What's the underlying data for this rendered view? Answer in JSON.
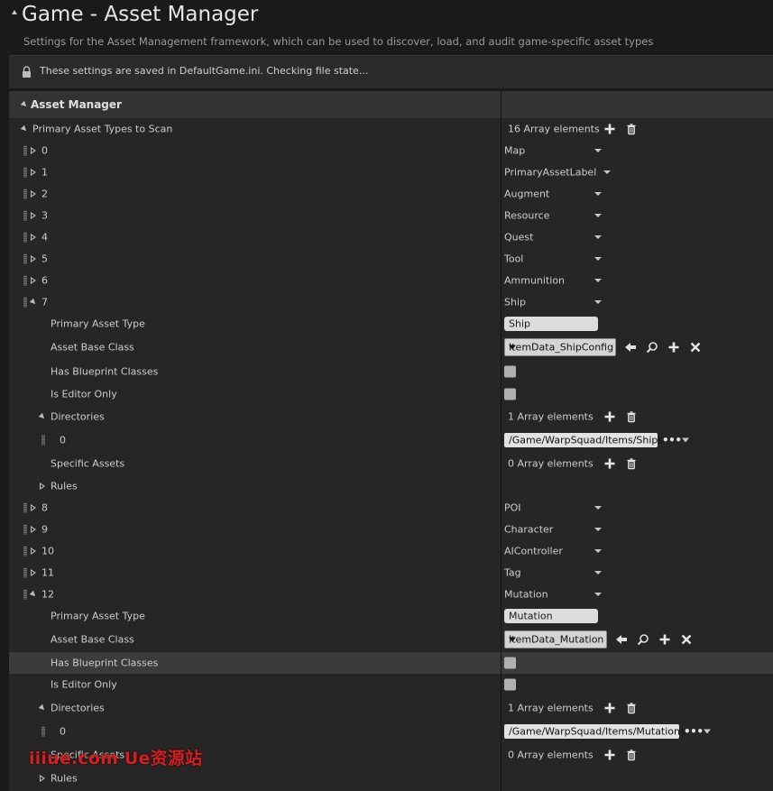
{
  "header": {
    "title": "Game - Asset Manager",
    "subtitle": "Settings for the Asset Management framework, which can be used to discover, load, and audit game-specific asset types"
  },
  "notice": {
    "text": "These settings are saved in DefaultGame.ini. Checking file state..."
  },
  "section": {
    "label": "Asset Manager"
  },
  "primary_types": {
    "label": "Primary Asset Types to Scan",
    "count": "16 Array elements"
  },
  "items": [
    {
      "index": "0",
      "value": "Map"
    },
    {
      "index": "1",
      "value": "PrimaryAssetLabel"
    },
    {
      "index": "2",
      "value": "Augment"
    },
    {
      "index": "3",
      "value": "Resource"
    },
    {
      "index": "4",
      "value": "Quest"
    },
    {
      "index": "5",
      "value": "Tool"
    },
    {
      "index": "6",
      "value": "Ammunition"
    },
    {
      "index": "7",
      "value": "Ship"
    },
    {
      "index": "8",
      "value": "POI"
    },
    {
      "index": "9",
      "value": "Character"
    },
    {
      "index": "10",
      "value": "AIController"
    },
    {
      "index": "11",
      "value": "Tag"
    },
    {
      "index": "12",
      "value": "Mutation"
    }
  ],
  "fields": {
    "primary_asset_type": "Primary Asset Type",
    "asset_base_class": "Asset Base Class",
    "has_blueprint_classes": "Has Blueprint Classes",
    "is_editor_only": "Is Editor Only",
    "directories": "Directories",
    "specific_assets": "Specific Assets",
    "rules": "Rules",
    "dir_index": "0"
  },
  "item7": {
    "primary_asset_type": "Ship",
    "base_class": "ItemData_ShipConfig",
    "has_blueprint_classes": false,
    "is_editor_only": false,
    "directories_count": "1 Array elements",
    "directory_path": "/Game/WarpSquad/Items/Ships",
    "specific_assets_count": "0 Array elements"
  },
  "item12": {
    "primary_asset_type": "Mutation",
    "base_class": "ItemData_Mutation",
    "has_blueprint_classes": false,
    "is_editor_only": false,
    "directories_count": "1 Array elements",
    "directory_path": "/Game/WarpSquad/Items/Mutations",
    "specific_assets_count": "0 Array elements"
  },
  "icons": {
    "lock": "lock-icon",
    "add": "plus-icon",
    "delete": "trash-icon",
    "use_selected": "arrow-left-icon",
    "browse": "magnifier-icon",
    "clear": "x-icon",
    "options": "ellipsis-icon",
    "dropdown": "chevron-down-icon"
  },
  "watermark": "iiiue.com Ue资源站",
  "colors": {
    "background": "#1a1a1a",
    "panel": "#262626",
    "section": "#333333",
    "highlight_row": "#3b3b3b",
    "watermark": "#d81e1e"
  }
}
